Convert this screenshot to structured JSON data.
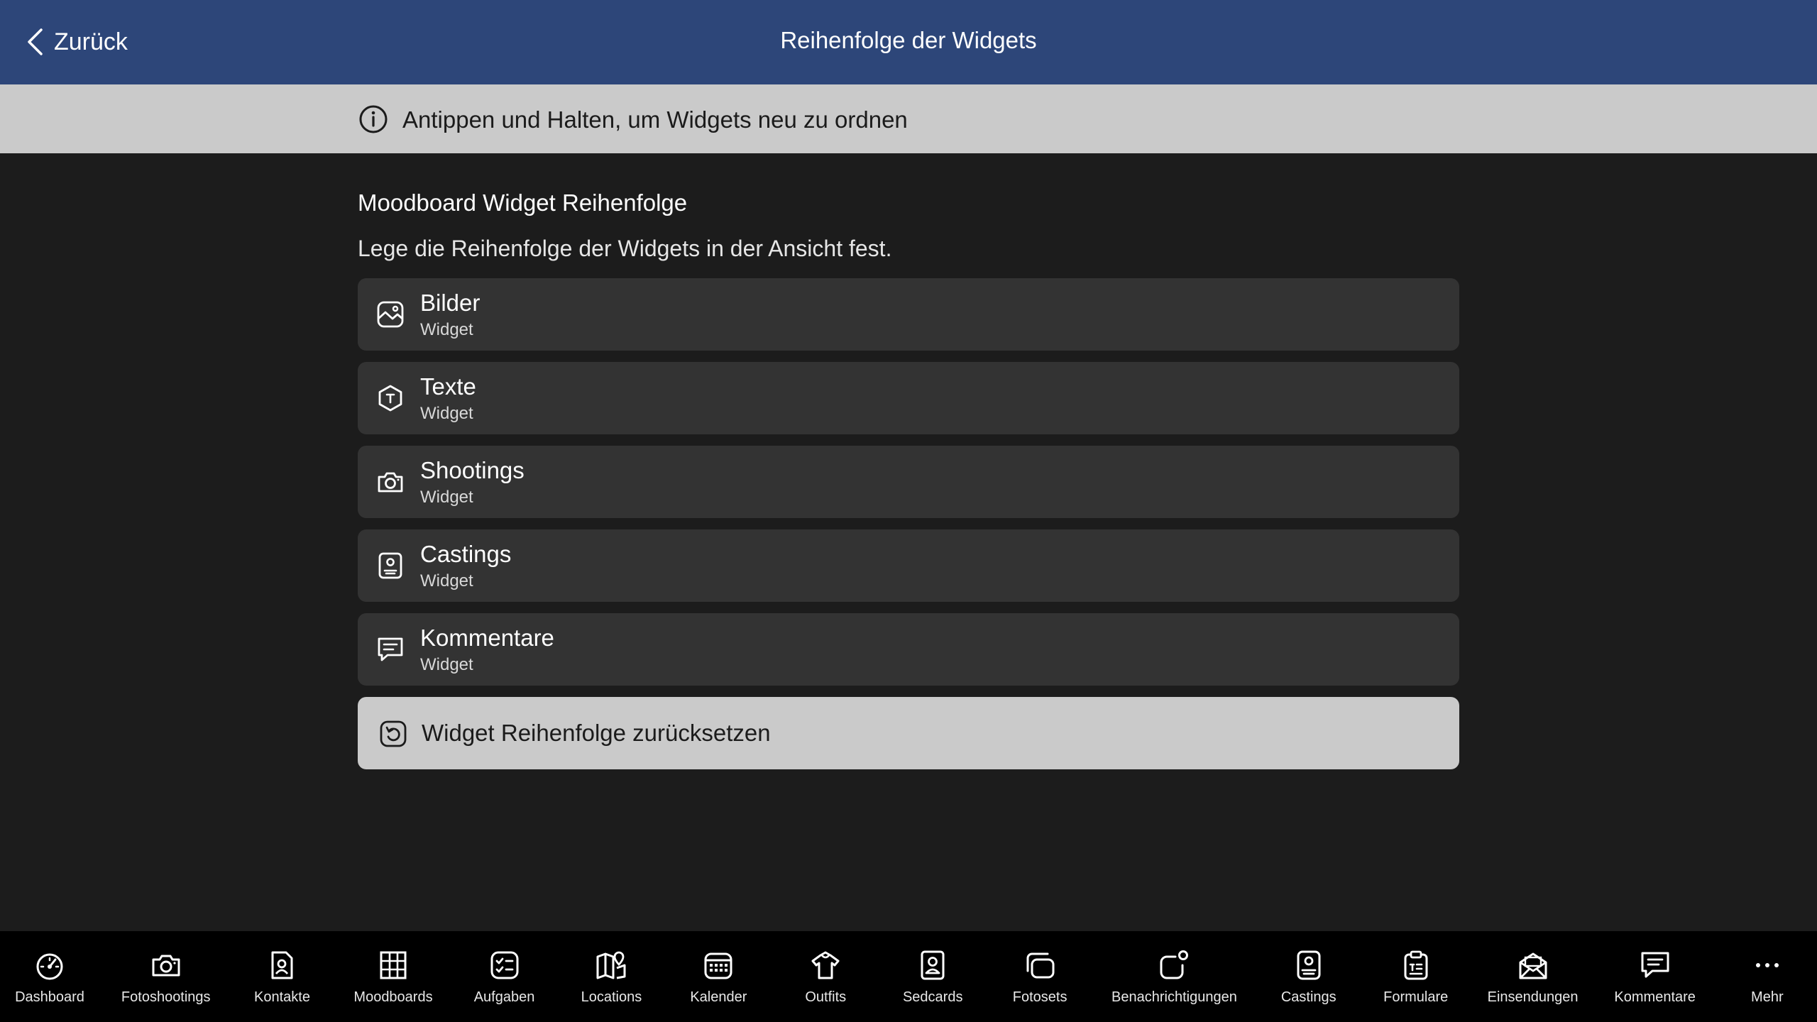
{
  "header": {
    "back_label": "Zurück",
    "title": "Reihenfolge der Widgets",
    "background": "#2d4679"
  },
  "hint": {
    "icon": "info-icon",
    "text": "Antippen und Halten, um Widgets neu zu ordnen"
  },
  "section": {
    "title": "Moodboard Widget Reihenfolge",
    "description": "Lege die Reihenfolge der Widgets in der Ansicht fest."
  },
  "widgets": [
    {
      "title": "Bilder",
      "subtitle": "Widget",
      "icon": "image-icon"
    },
    {
      "title": "Texte",
      "subtitle": "Widget",
      "icon": "text-hexagon-icon"
    },
    {
      "title": "Shootings",
      "subtitle": "Widget",
      "icon": "camera-icon"
    },
    {
      "title": "Castings",
      "subtitle": "Widget",
      "icon": "id-card-icon"
    },
    {
      "title": "Kommentare",
      "subtitle": "Widget",
      "icon": "comment-icon"
    }
  ],
  "reset": {
    "label": "Widget Reihenfolge zurücksetzen",
    "icon": "reset-icon"
  },
  "tabs": [
    {
      "label": "Dashboard",
      "icon": "speedometer-icon"
    },
    {
      "label": "Fotoshootings",
      "icon": "camera-icon"
    },
    {
      "label": "Kontakte",
      "icon": "contact-icon"
    },
    {
      "label": "Moodboards",
      "icon": "grid-icon"
    },
    {
      "label": "Aufgaben",
      "icon": "checklist-icon"
    },
    {
      "label": "Locations",
      "icon": "map-icon"
    },
    {
      "label": "Kalender",
      "icon": "calendar-icon"
    },
    {
      "label": "Outfits",
      "icon": "shirt-icon"
    },
    {
      "label": "Sedcards",
      "icon": "sedcard-icon"
    },
    {
      "label": "Fotosets",
      "icon": "photo-stack-icon"
    },
    {
      "label": "Benachrichtigungen",
      "icon": "notification-icon"
    },
    {
      "label": "Castings",
      "icon": "id-card-icon"
    },
    {
      "label": "Formulare",
      "icon": "clipboard-icon"
    },
    {
      "label": "Einsendungen",
      "icon": "envelope-icon"
    },
    {
      "label": "Kommentare",
      "icon": "comment-icon"
    },
    {
      "label": "Mehr",
      "icon": "more-icon"
    }
  ]
}
